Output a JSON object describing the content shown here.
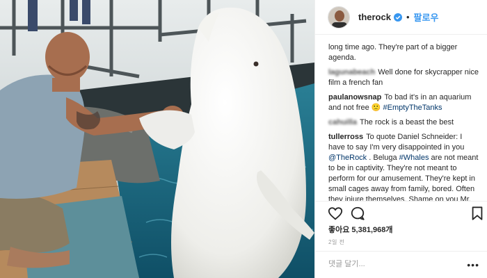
{
  "post": {
    "username": "therock",
    "follow_label": "팔로우",
    "separator": "•"
  },
  "comments": [
    {
      "user": "",
      "text": "long time ago. They're part of a bigger agenda."
    },
    {
      "user": "lagunabeach",
      "text": "Well done for skycrapper nice film a french fan"
    },
    {
      "user": "paulanowsnap",
      "text": "To bad it's in an aquarium and not free 🙁 ",
      "tag": "#EmptyTheTanks"
    },
    {
      "user": "cahuilla",
      "text": "The rock is a beast the best"
    },
    {
      "user": "tullerross",
      "text_a": "To quote Daniel Schneider: I have to say I'm very disappointed in you ",
      "mention": "@TheRock",
      "text_b": " . Beluga ",
      "tag": "#Whales",
      "text_c": " are not meant to be in captivity. They're not meant to perform for our amusement. They're kept in small cages away from family, bored. Often they injure themselves. Shame on you Mr. Dwayne Johnson"
    }
  ],
  "stats": {
    "likes_label": "좋아요 5,381,968개",
    "time_ago": "2일 전"
  },
  "comment_input": {
    "placeholder": "댓글 달기..."
  },
  "icons": {
    "like": "heart-icon",
    "comment": "comment-bubble-icon",
    "save": "bookmark-icon",
    "verified": "verified-badge-icon",
    "more": "more-options-icon"
  },
  "colors": {
    "link": "#003569",
    "follow": "#3897f0",
    "verified": "#3897f0",
    "water": "#1f6f8a"
  }
}
